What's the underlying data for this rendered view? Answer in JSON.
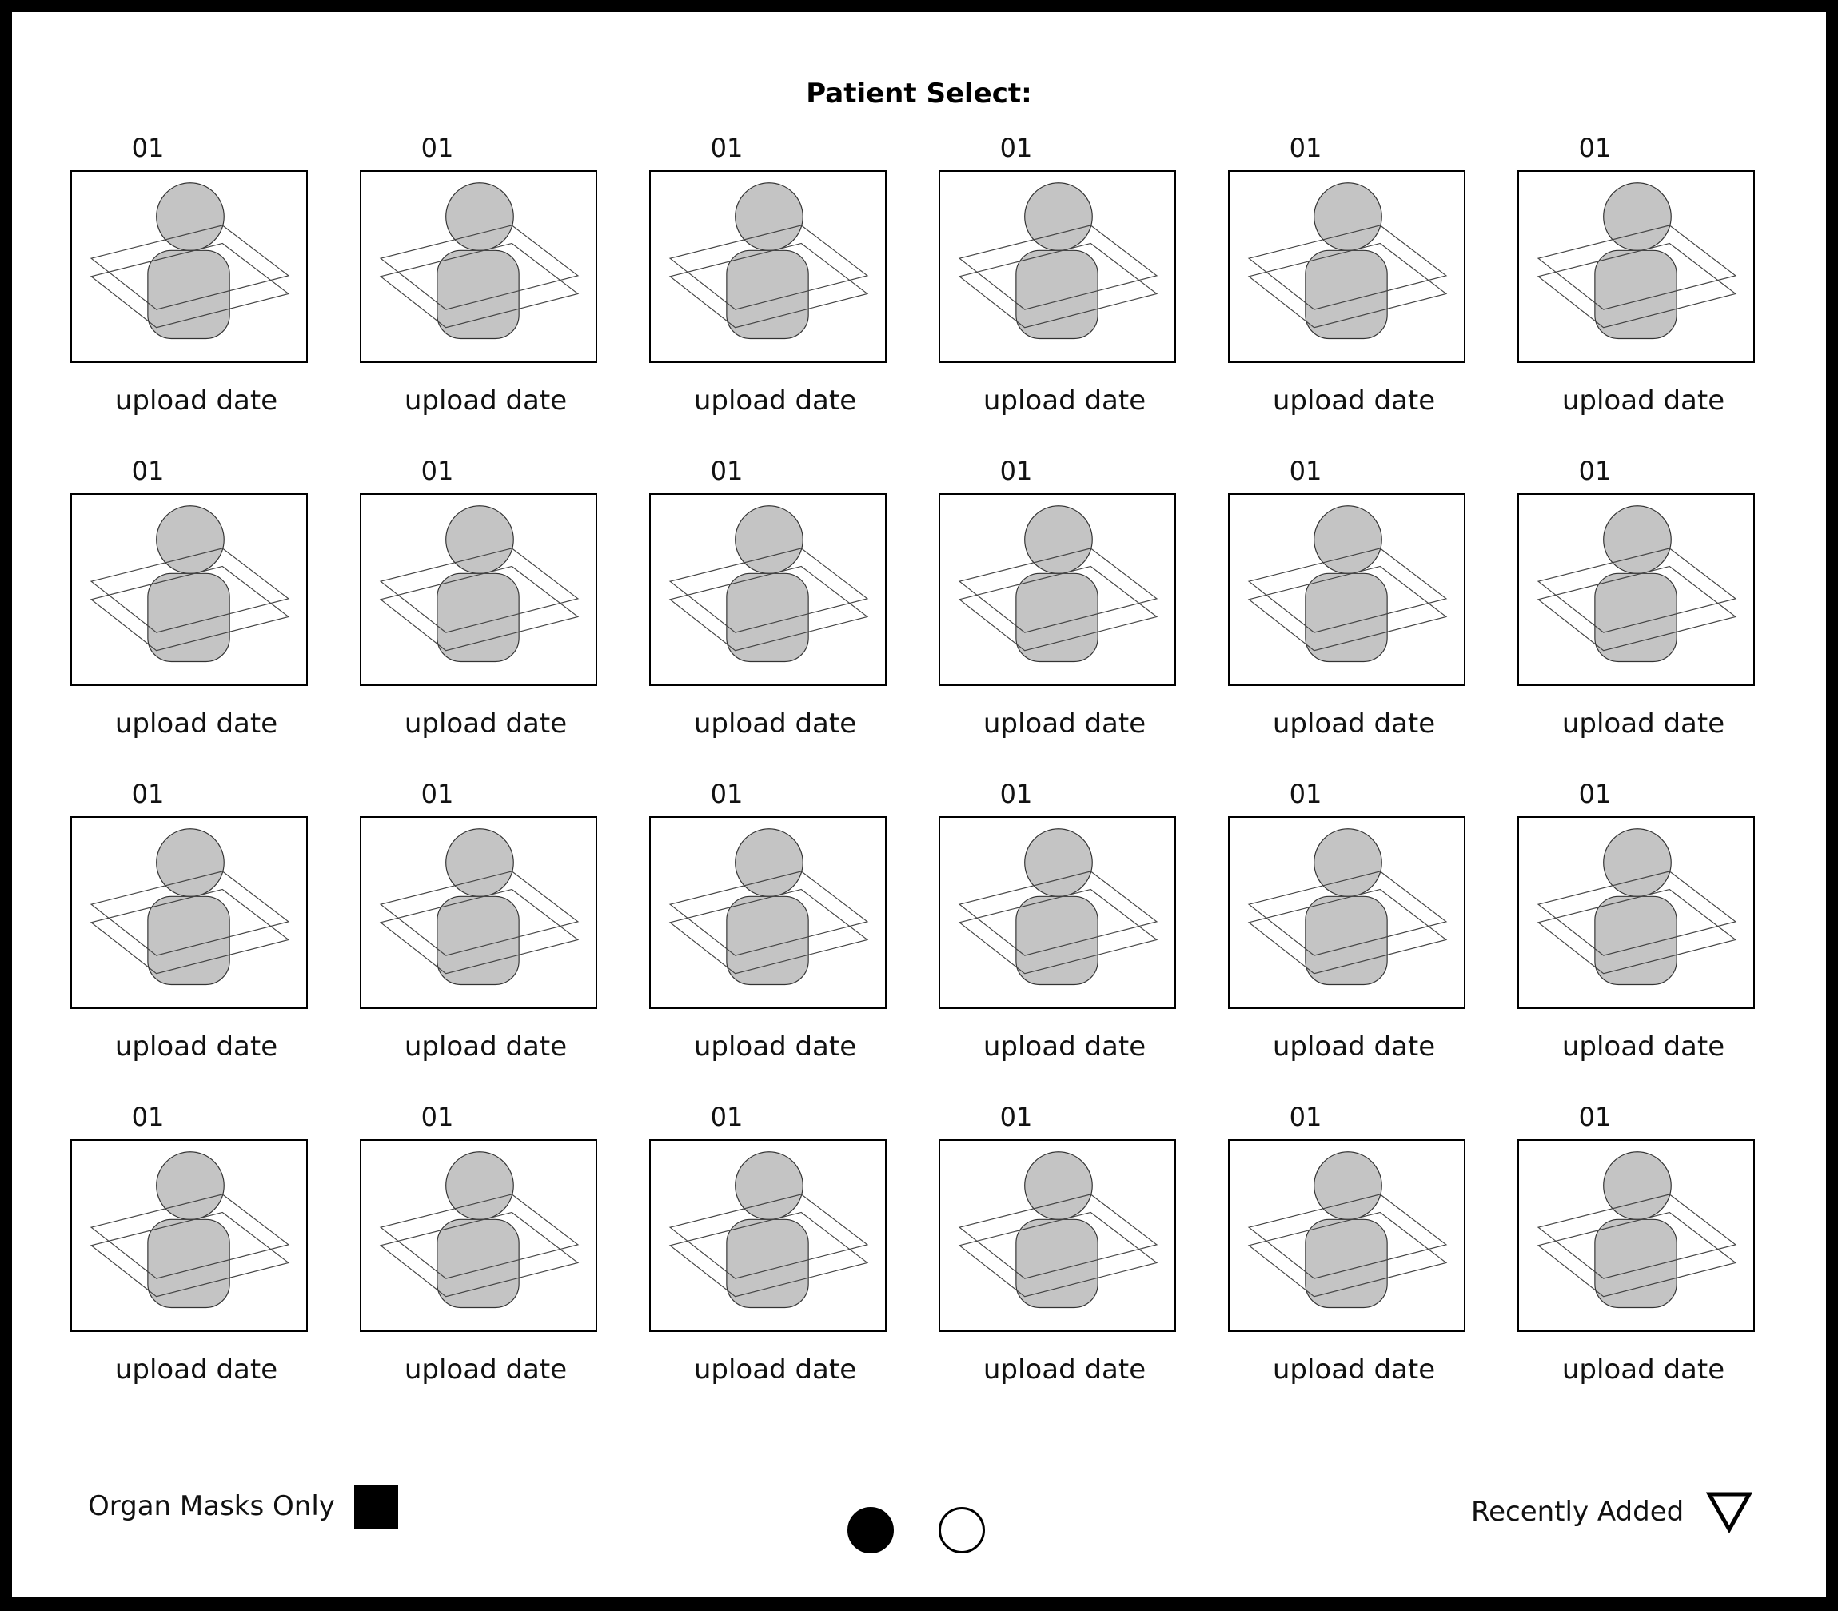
{
  "header": {
    "title": "Patient Select:"
  },
  "patients": [
    {
      "id": "01",
      "date_label": "upload date"
    },
    {
      "id": "01",
      "date_label": "upload date"
    },
    {
      "id": "01",
      "date_label": "upload date"
    },
    {
      "id": "01",
      "date_label": "upload date"
    },
    {
      "id": "01",
      "date_label": "upload date"
    },
    {
      "id": "01",
      "date_label": "upload date"
    },
    {
      "id": "01",
      "date_label": "upload date"
    },
    {
      "id": "01",
      "date_label": "upload date"
    },
    {
      "id": "01",
      "date_label": "upload date"
    },
    {
      "id": "01",
      "date_label": "upload date"
    },
    {
      "id": "01",
      "date_label": "upload date"
    },
    {
      "id": "01",
      "date_label": "upload date"
    },
    {
      "id": "01",
      "date_label": "upload date"
    },
    {
      "id": "01",
      "date_label": "upload date"
    },
    {
      "id": "01",
      "date_label": "upload date"
    },
    {
      "id": "01",
      "date_label": "upload date"
    },
    {
      "id": "01",
      "date_label": "upload date"
    },
    {
      "id": "01",
      "date_label": "upload date"
    },
    {
      "id": "01",
      "date_label": "upload date"
    },
    {
      "id": "01",
      "date_label": "upload date"
    },
    {
      "id": "01",
      "date_label": "upload date"
    },
    {
      "id": "01",
      "date_label": "upload date"
    },
    {
      "id": "01",
      "date_label": "upload date"
    },
    {
      "id": "01",
      "date_label": "upload date"
    }
  ],
  "footer": {
    "filter_label": "Organ Masks Only",
    "filter_checked": true,
    "pagination": {
      "current_page": 1,
      "total_pages": 2
    },
    "sort_label": "Recently Added",
    "sort_icon": "triangle-down-icon"
  },
  "colors": {
    "figure_fill": "#c4c4c4",
    "border": "#000000",
    "background": "#ffffff"
  }
}
